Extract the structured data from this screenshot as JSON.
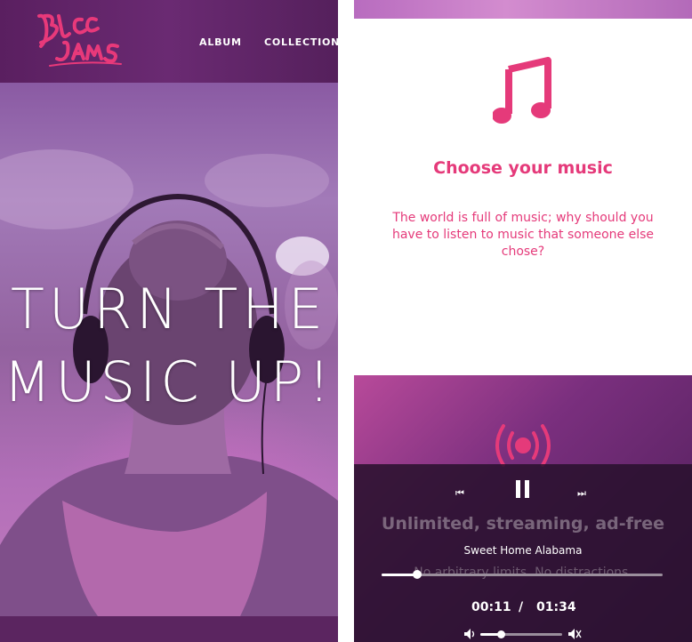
{
  "navbar": {
    "logo_text": "Bloc Jams",
    "links": [
      {
        "label": "ALBUM"
      },
      {
        "label": "COLLECTION"
      }
    ]
  },
  "hero": {
    "title_line1": "TURN THE",
    "title_line2": "MUSIC UP!"
  },
  "selling_point": {
    "icon": "music-note-icon",
    "title": "Choose your music",
    "description": "The world is full of music; why should you have to listen to music that someone else chose?"
  },
  "next_selling_point": {
    "icon": "radio-icon",
    "title": "Unlimited, streaming, ad-free",
    "description": "No arbitrary limits. No distractions."
  },
  "player": {
    "song_name": "Sweet Home Alabama",
    "current_time": "00:11",
    "separator": "/",
    "total_time": "01:34",
    "seek_progress": 0.125,
    "volume_level": 0.25,
    "controls": {
      "previous_icon": "previous-icon",
      "pause_icon": "pause-icon",
      "next_icon": "next-icon",
      "volume_down_icon": "volume-down-icon",
      "volume_up_icon": "volume-mute-icon"
    }
  },
  "colors": {
    "brand_pink": "#e53a7a",
    "nav_purple": "#5a1f60",
    "player_bg": "#28102c"
  }
}
